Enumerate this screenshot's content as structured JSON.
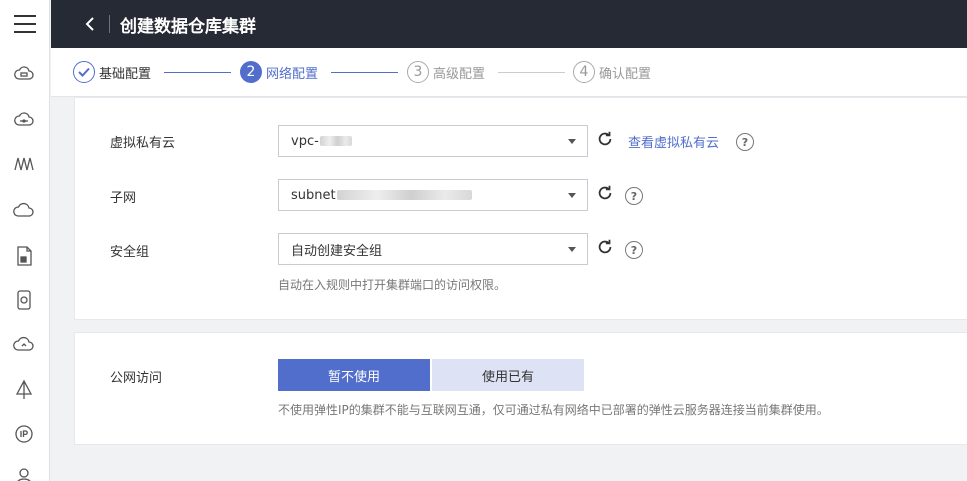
{
  "header": {
    "title": "创建数据仓库集群"
  },
  "sidebar": {
    "icons": [
      "ecs-icon",
      "bms-icon",
      "topology-icon",
      "cloud-icon",
      "document-icon",
      "storage-icon",
      "cloud-sync-icon",
      "vpc-icon",
      "ip-icon",
      "users-icon"
    ]
  },
  "steps": [
    {
      "number": "1",
      "label": "基础配置",
      "state": "done"
    },
    {
      "number": "2",
      "label": "网络配置",
      "state": "active"
    },
    {
      "number": "3",
      "label": "高级配置",
      "state": "todo"
    },
    {
      "number": "4",
      "label": "确认配置",
      "state": "todo"
    }
  ],
  "network": {
    "vpc": {
      "label": "虚拟私有云",
      "value": "vpc-",
      "view_link": "查看虚拟私有云"
    },
    "subnet": {
      "label": "子网",
      "value": "subnet"
    },
    "security_group": {
      "label": "安全组",
      "value": "自动创建安全组",
      "hint": "自动在入规则中打开集群端口的访问权限。"
    },
    "help_glyph": "?"
  },
  "public_access": {
    "label": "公网访问",
    "options": [
      "暂不使用",
      "使用已有"
    ],
    "selected": "暂不使用",
    "hint": "不使用弹性IP的集群不能与互联网互通，仅可通过私有网络中已部署的弹性云服务器连接当前集群使用。"
  },
  "colors": {
    "accent": "#526ecc",
    "topbar": "#252a34",
    "secondary_button": "#dde3f5"
  }
}
